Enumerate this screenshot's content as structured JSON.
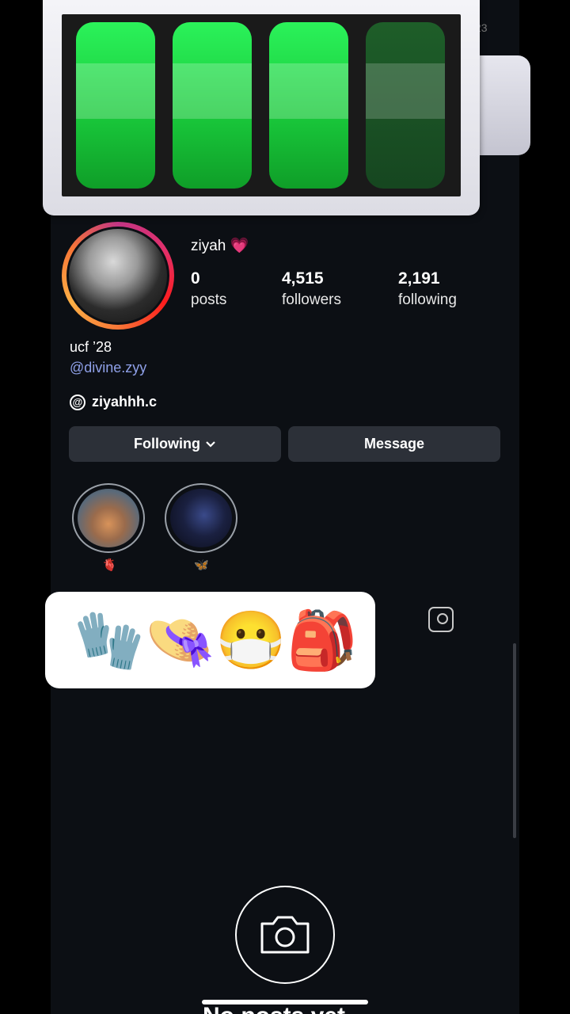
{
  "status": {
    "clock_fragment": "23"
  },
  "battery": {
    "cells_total": 4,
    "cells_filled": 3,
    "fill_color": "#22e04a"
  },
  "profile": {
    "username": "ziyah",
    "username_emoji": "💗",
    "posts": {
      "count": "0",
      "label": "posts"
    },
    "followers": {
      "count": "4,515",
      "label": "followers"
    },
    "following": {
      "count": "2,191",
      "label": "following"
    },
    "bio": "ucf ’28",
    "handle": "@divine.zyy",
    "threads": "ziyahhh.c"
  },
  "actions": {
    "following_label": "Following",
    "message_label": "Message"
  },
  "highlights": [
    {
      "label": "🫀",
      "icon": "anatomical-heart"
    },
    {
      "label": "🦋",
      "icon": "butterfly"
    }
  ],
  "emoji_sticker": [
    "🧤",
    "👒",
    "😷",
    "🎒"
  ],
  "bottom": {
    "partial_text": "No posts yet"
  },
  "colors": {
    "link": "#8fa0e8",
    "button_bg": "#2c3038",
    "background": "#0c0f14"
  }
}
